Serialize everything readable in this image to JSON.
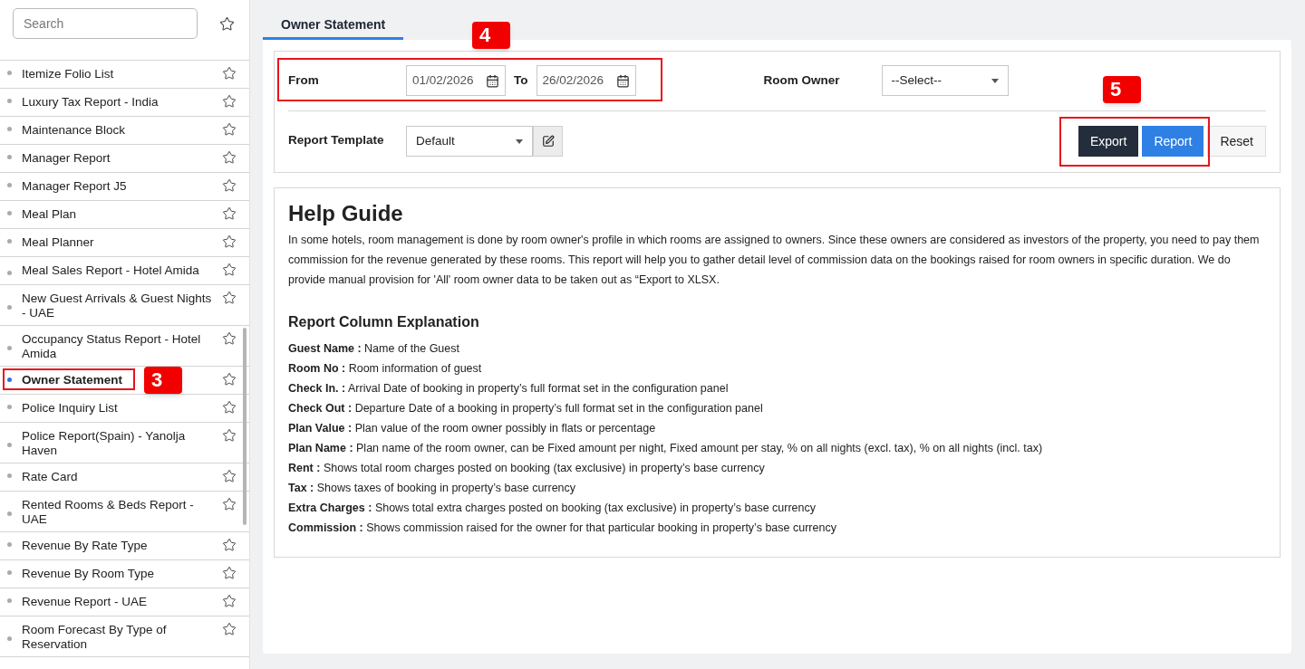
{
  "sidebar": {
    "search": {
      "placeholder": "Search"
    },
    "items": [
      {
        "label": "Itemize Folio List",
        "selected": false
      },
      {
        "label": "Luxury Tax Report - India",
        "selected": false
      },
      {
        "label": "Maintenance Block",
        "selected": false
      },
      {
        "label": "Manager Report",
        "selected": false
      },
      {
        "label": "Manager Report J5",
        "selected": false
      },
      {
        "label": "Meal Plan",
        "selected": false
      },
      {
        "label": "Meal Planner",
        "selected": false
      },
      {
        "label": "Meal Sales Report - Hotel Amida",
        "selected": false
      },
      {
        "label": "New Guest Arrivals & Guest Nights - UAE",
        "selected": false
      },
      {
        "label": "Occupancy Status Report - Hotel Amida",
        "selected": false
      },
      {
        "label": "Owner Statement",
        "selected": true
      },
      {
        "label": "Police Inquiry List",
        "selected": false
      },
      {
        "label": "Police Report(Spain) - Yanolja Haven",
        "selected": false
      },
      {
        "label": "Rate Card",
        "selected": false
      },
      {
        "label": "Rented Rooms & Beds Report - UAE",
        "selected": false
      },
      {
        "label": "Revenue By Rate Type",
        "selected": false
      },
      {
        "label": "Revenue By Room Type",
        "selected": false
      },
      {
        "label": "Revenue Report - UAE",
        "selected": false
      },
      {
        "label": "Room Forecast By Type of Reservation",
        "selected": false
      }
    ]
  },
  "tabs": [
    {
      "label": "Owner Statement",
      "selected": true
    }
  ],
  "filters": {
    "from_label": "From",
    "from_value": "01/02/2026",
    "to_label": "To",
    "to_value": "26/02/2026",
    "room_owner_label": "Room Owner",
    "room_owner_value": "--Select--",
    "template_label": "Report Template",
    "template_value": "Default"
  },
  "buttons": [
    {
      "label": "Export",
      "kind": "dark"
    },
    {
      "label": "Report",
      "kind": "primary"
    },
    {
      "label": "Reset",
      "kind": "plain"
    }
  ],
  "help": {
    "title": "Help Guide",
    "intro": "In some hotels, room management is done by room owner's profile in which rooms are assigned to owners. Since these owners are considered as investors of the property, you need to pay them commission for the revenue generated by these rooms. This report will help you to gather detail level of commission data on the bookings raised for room owners in specific duration. We do provide manual provision for 'All' room owner data to be taken out as “Export to XLSX.",
    "subtitle": "Report Column Explanation",
    "columns": [
      "**Guest Name :** Name of the Guest",
      "**Room No :** Room information of guest",
      "**Check In. :** Arrival Date of booking in property’s full format set in the configuration panel",
      "**Check Out :** Departure Date of a booking in property’s full format set in the configuration panel",
      "**Plan Value :** Plan value of the room owner possibly in flats or percentage",
      "**Plan Name :** Plan name of the room owner, can be Fixed amount per night, Fixed amount per stay, % on all nights (excl. tax), % on all nights (incl. tax)",
      "**Rent :** Shows total room charges posted on booking (tax exclusive) in property’s base currency",
      "**Tax :** Shows taxes of booking in property’s base currency",
      "**Extra Charges :** Shows total extra charges posted on booking (tax exclusive) in property’s base currency",
      "**Commission :** Shows commission raised for the owner for that particular booking in property’s base currency"
    ]
  },
  "callouts": [
    "3",
    "4",
    "5"
  ]
}
